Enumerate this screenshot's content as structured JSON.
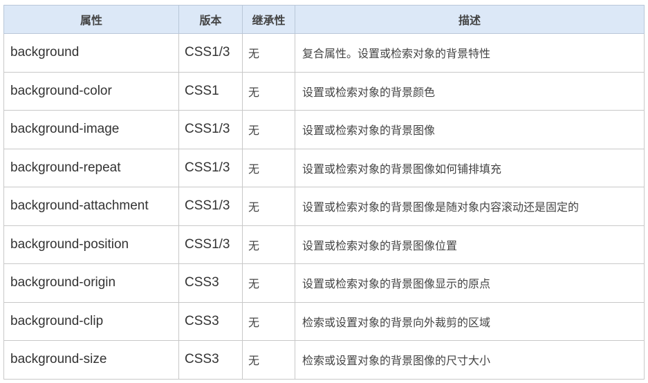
{
  "table": {
    "headers": [
      "属性",
      "版本",
      "继承性",
      "描述"
    ],
    "rows": [
      {
        "property": "background",
        "version": "CSS1/3",
        "inherit": "无",
        "description": "复合属性。设置或检索对象的背景特性",
        "color": "#6b5fc9"
      },
      {
        "property": "background-color",
        "version": "CSS1",
        "inherit": "无",
        "description": "设置或检索对象的背景颜色",
        "color": "#1a7f1a"
      },
      {
        "property": "background-image",
        "version": "CSS1/3",
        "inherit": "无",
        "description": "设置或检索对象的背景图像",
        "color": "#6b5fc9"
      },
      {
        "property": "background-repeat",
        "version": "CSS1/3",
        "inherit": "无",
        "description": "设置或检索对象的背景图像如何铺排填充",
        "color": "#6b5fc9"
      },
      {
        "property": "background-attachment",
        "version": "CSS1/3",
        "inherit": "无",
        "description": "设置或检索对象的背景图像是随对象内容滚动还是固定的",
        "color": "#6b5fc9"
      },
      {
        "property": "background-position",
        "version": "CSS1/3",
        "inherit": "无",
        "description": "设置或检索对象的背景图像位置",
        "color": "#6b5fc9"
      },
      {
        "property": "background-origin",
        "version": "CSS3",
        "inherit": "无",
        "description": "设置或检索对象的背景图像显示的原点",
        "color": "#ee7400"
      },
      {
        "property": "background-clip",
        "version": "CSS3",
        "inherit": "无",
        "description": "检索或设置对象的背景向外裁剪的区域",
        "color": "#ee7400"
      },
      {
        "property": "background-size",
        "version": "CSS3",
        "inherit": "无",
        "description": "检索或设置对象的背景图像的尺寸大小",
        "color": "#ee7400"
      }
    ]
  },
  "colors": {
    "header_bg": "#dce8f7",
    "css1_3": "#6b5fc9",
    "css1": "#1a7f1a",
    "css3": "#ee7400"
  }
}
